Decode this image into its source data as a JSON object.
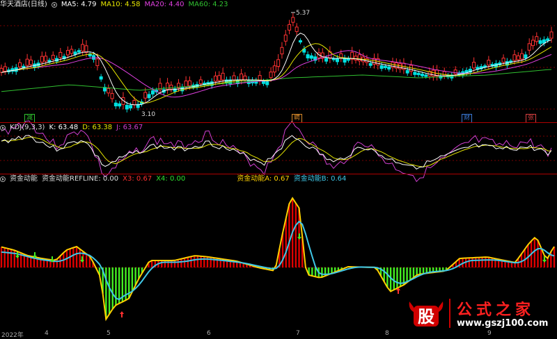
{
  "price_header": {
    "name": "华天酒店(日线)",
    "ma5": "MA5: 4.79",
    "ma10": "MA10: 4.58",
    "ma20": "MA20: 4.40",
    "ma60": "MA60: 4.23"
  },
  "price_annotations": {
    "high": "5.37",
    "low": "3.10"
  },
  "events": [
    {
      "label": "减",
      "color": "#2ec02e"
    },
    {
      "label": "聘",
      "color": "#d88a2a"
    },
    {
      "label": "财",
      "color": "#3b7bd8"
    },
    {
      "label": "张",
      "color": "#d84040"
    }
  ],
  "kdj_header": {
    "name": "KDJ(9,3,3)",
    "k": "K: 63.48",
    "d": "D: 63.38",
    "j": "J: 63.67"
  },
  "fund_header": {
    "name": "资金动能",
    "refline": "资金动能REFLINE: 0.00",
    "x3": "X3: 0.67",
    "x4": "X4: 0.00",
    "a": "资金动能A: 0.67",
    "b": "资金动能B: 0.64"
  },
  "date_axis": [
    "2022年",
    "4",
    "5",
    "6",
    "7",
    "8",
    "9"
  ],
  "watermark": {
    "logo_char": "股",
    "title": "公式之家",
    "url": "www.gszj100.com"
  },
  "colors": {
    "up": "#ff3232",
    "down": "#00e0e0",
    "ma5": "#ffffff",
    "ma10": "#e6e600",
    "ma20": "#e040e0",
    "ma60": "#30c030",
    "bar_pos": "#e00000",
    "bar_neg": "#44ee22",
    "line_a": "#ffd000",
    "line_b": "#40c8e8",
    "grid": "#b00000"
  }
}
